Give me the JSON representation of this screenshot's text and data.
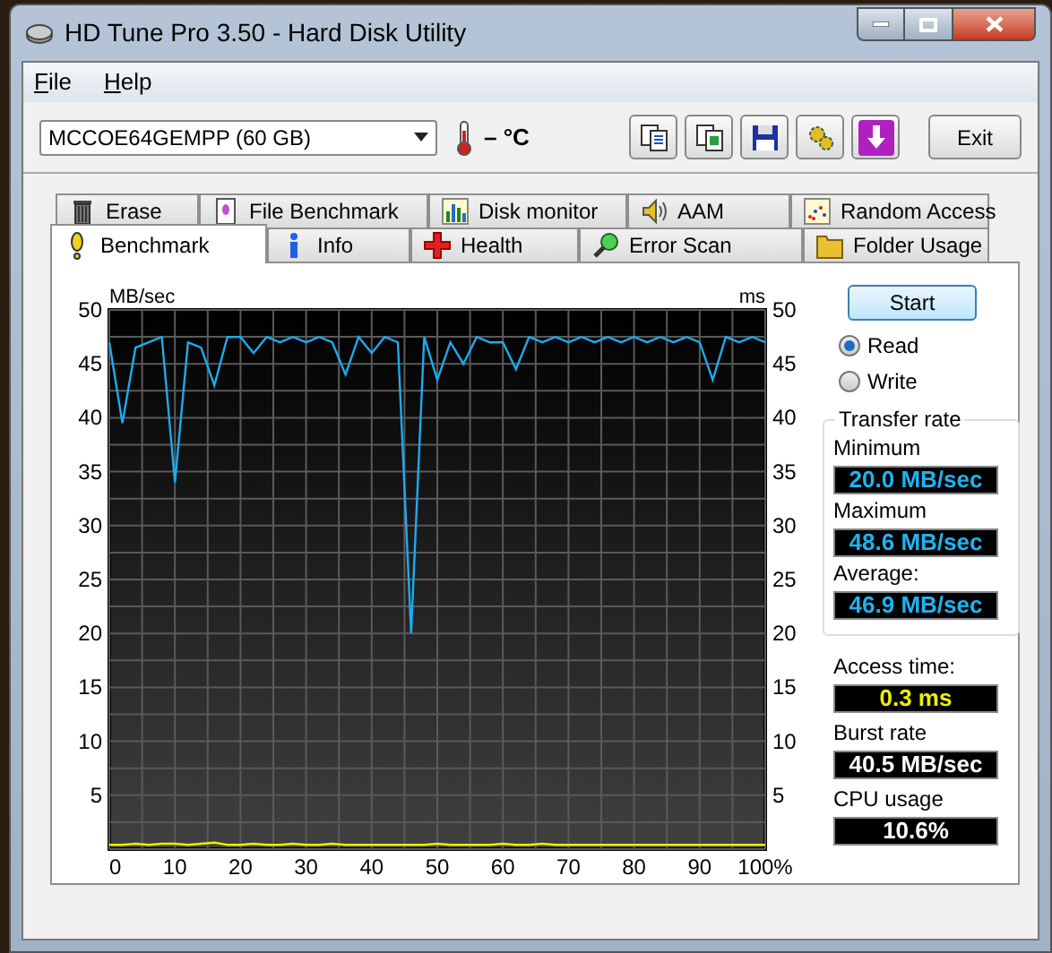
{
  "window": {
    "title": "HD Tune Pro 3.50 - Hard Disk Utility"
  },
  "menu": [
    {
      "label": "File"
    },
    {
      "label": "Help"
    }
  ],
  "drive_select": {
    "value": "MCCOE64GEMPP (60 GB)"
  },
  "temperature": "– °C",
  "exit_button": "Exit",
  "tab_rows": [
    [
      {
        "label": "Erase",
        "selected": false
      },
      {
        "label": "File Benchmark",
        "selected": false
      },
      {
        "label": "Disk monitor",
        "selected": false
      },
      {
        "label": "AAM",
        "selected": false
      },
      {
        "label": "Random Access",
        "selected": false
      }
    ],
    [
      {
        "label": "Benchmark",
        "selected": true
      },
      {
        "label": "Info",
        "selected": false
      },
      {
        "label": "Health",
        "selected": false
      },
      {
        "label": "Error Scan",
        "selected": false
      },
      {
        "label": "Folder Usage",
        "selected": false
      }
    ]
  ],
  "chart": {
    "right_axis": {
      "label": "ms",
      "ticks": [
        "50",
        "45",
        "40",
        "35",
        "30",
        "25",
        "20",
        "15",
        "10",
        "5"
      ]
    },
    "chart_data": {
      "type": "line",
      "ylabel": "MB/sec",
      "grid": true,
      "xlim": [
        0,
        100
      ],
      "ylim": [
        0,
        50
      ],
      "xticks": [
        0,
        10,
        20,
        30,
        40,
        50,
        60,
        70,
        80,
        90,
        {
          "value": 100,
          "label": "100%"
        }
      ],
      "yticks": [
        5,
        10,
        15,
        20,
        25,
        30,
        35,
        40,
        45,
        50
      ],
      "x": [
        0,
        2,
        4,
        6,
        8,
        10,
        12,
        14,
        16,
        18,
        20,
        22,
        24,
        26,
        28,
        30,
        32,
        34,
        36,
        38,
        40,
        42,
        44,
        46,
        48,
        50,
        52,
        54,
        56,
        58,
        60,
        62,
        64,
        66,
        68,
        70,
        72,
        74,
        76,
        78,
        80,
        82,
        84,
        86,
        88,
        90,
        92,
        94,
        96,
        98,
        100
      ],
      "series": [
        {
          "color": "#1eaaf0",
          "values": [
            47,
            39.5,
            46.5,
            47,
            47.5,
            34,
            47,
            46.5,
            43,
            47.5,
            47.5,
            46,
            47.5,
            47,
            47.5,
            47,
            47.5,
            47,
            44,
            47.5,
            46,
            47.5,
            47,
            20,
            47.5,
            43.5,
            47,
            45,
            47.5,
            47,
            47,
            44.5,
            47.5,
            47,
            47.5,
            47,
            47.5,
            47,
            47.5,
            47,
            47.5,
            47,
            47.5,
            47,
            47.5,
            47,
            43.5,
            47.5,
            47,
            47.5,
            47
          ]
        },
        {
          "color": "#f0f000",
          "values": [
            0.4,
            0.4,
            0.5,
            0.4,
            0.5,
            0.5,
            0.4,
            0.5,
            0.6,
            0.4,
            0.4,
            0.5,
            0.4,
            0.4,
            0.5,
            0.4,
            0.4,
            0.5,
            0.4,
            0.4,
            0.4,
            0.4,
            0.4,
            0.4,
            0.4,
            0.5,
            0.4,
            0.4,
            0.4,
            0.4,
            0.5,
            0.4,
            0.4,
            0.5,
            0.4,
            0.4,
            0.4,
            0.4,
            0.4,
            0.4,
            0.4,
            0.4,
            0.4,
            0.4,
            0.4,
            0.4,
            0.4,
            0.4,
            0.4,
            0.4,
            0.4
          ]
        }
      ]
    }
  },
  "start_button": "Start",
  "mode": [
    {
      "label": "Read",
      "selected": true
    },
    {
      "label": "Write",
      "selected": false
    }
  ],
  "transfer_rate": {
    "title": "Transfer rate",
    "readouts": [
      {
        "label": "Minimum",
        "value": "20.0 MB/sec",
        "kind": "rate"
      },
      {
        "label": "Maximum",
        "value": "48.6 MB/sec",
        "kind": "rate"
      },
      {
        "label": "Average:",
        "value": "46.9 MB/sec",
        "kind": "rate"
      }
    ]
  },
  "readouts": [
    {
      "label": "Access time:",
      "value": "0.3 ms",
      "kind": "time"
    },
    {
      "label": "Burst rate",
      "value": "40.5 MB/sec",
      "kind": "plain"
    },
    {
      "label": "CPU usage",
      "value": "10.6%",
      "kind": "plain"
    }
  ]
}
